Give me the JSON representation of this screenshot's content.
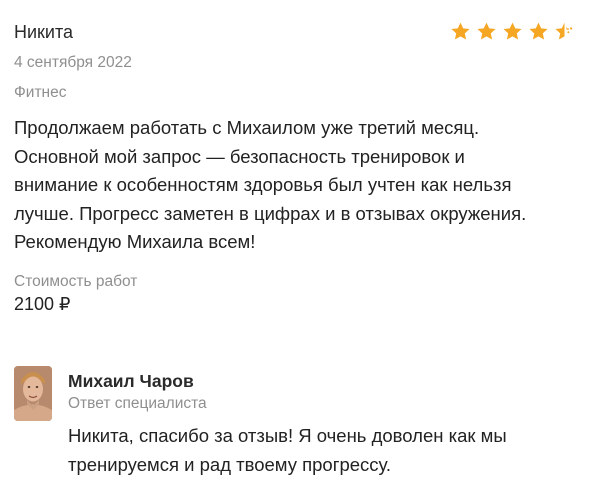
{
  "review": {
    "author": "Никита",
    "rating": 4.5,
    "date": "4 сентября 2022",
    "category": "Фитнес",
    "text_lines": [
      "Продолжаем работать с Михаилом уже третий месяц.",
      "Основной мой запрос — безопасность тренировок и",
      "внимание к особенностям здоровья был учтен как нельзя",
      "лучше. Прогресс заметен в цифрах и в отзывах окружения.",
      "Рекомендую Михаила всем!"
    ],
    "cost_label": "Стоимость работ",
    "cost_value": "2100 ₽"
  },
  "reply": {
    "name": "Михаил Чаров",
    "role": "Ответ специалиста",
    "text_lines": [
      "Никита, спасибо за отзыв! Я очень доволен как мы",
      "тренируемся и рад твоему прогрессу."
    ]
  },
  "colors": {
    "star": "#f5a623",
    "muted_text": "#8f8f8f"
  },
  "icons": {
    "star_full": "star-icon",
    "star_half": "star-half-icon"
  }
}
